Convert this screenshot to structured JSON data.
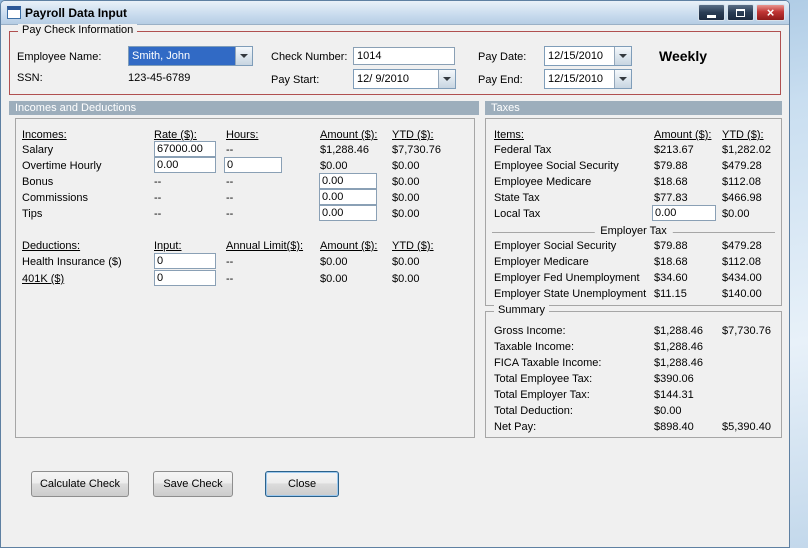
{
  "window": {
    "title": "Payroll Data Input",
    "close_glyph": "×",
    "icons": {
      "minimize": "minimize-icon",
      "maximize": "maximize-icon",
      "close": "close-icon",
      "dropdown": "dropdown-arrow-icon"
    }
  },
  "paycheck": {
    "legend": "Pay Check Information",
    "employee_label": "Employee Name:",
    "employee_value": "Smith, John",
    "ssn_label": "SSN:",
    "ssn_value": "123-45-6789",
    "check_label": "Check Number:",
    "check_value": "1014",
    "paystart_label": "Pay Start:",
    "paystart_value": "12/ 9/2010",
    "paydate_label": "Pay Date:",
    "paydate_value": "12/15/2010",
    "payend_label": "Pay End:",
    "payend_value": "12/15/2010",
    "frequency": "Weekly"
  },
  "section_headers": {
    "left": "Incomes and Deductions",
    "right": "Taxes"
  },
  "incomes": {
    "cols": {
      "name": "Incomes:",
      "rate": "Rate ($):",
      "hours": "Hours:",
      "amount": "Amount ($):",
      "ytd": "YTD ($):"
    },
    "salary": {
      "label": "Salary",
      "rate": "67000.00",
      "hours": "--",
      "amount": "$1,288.46",
      "ytd": "$7,730.76"
    },
    "overtime": {
      "label": "Overtime Hourly",
      "rate": "0.00",
      "hours": "0",
      "amount": "$0.00",
      "ytd": "$0.00"
    },
    "bonus": {
      "label": "Bonus",
      "rate": "--",
      "hours": "--",
      "amount": "0.00",
      "ytd": "$0.00"
    },
    "commissions": {
      "label": "Commissions",
      "rate": "--",
      "hours": "--",
      "amount": "0.00",
      "ytd": "$0.00"
    },
    "tips": {
      "label": "Tips",
      "rate": "--",
      "hours": "--",
      "amount": "0.00",
      "ytd": "$0.00"
    }
  },
  "deductions": {
    "cols": {
      "name": "Deductions:",
      "input": "Input:",
      "limit": "Annual Limit($):",
      "amount": "Amount ($):",
      "ytd": "YTD ($):"
    },
    "health": {
      "label": "Health Insurance  ($)",
      "input": "0",
      "limit": "--",
      "amount": "$0.00",
      "ytd": "$0.00"
    },
    "k401": {
      "label": "401K  ($)",
      "input": "0",
      "limit": "--",
      "amount": "$0.00",
      "ytd": "$0.00"
    }
  },
  "taxes": {
    "cols": {
      "items": "Items:",
      "amount": "Amount ($):",
      "ytd": "YTD ($):"
    },
    "rows": [
      {
        "label": "Federal Tax",
        "amount": "$213.67",
        "ytd": "$1,282.02"
      },
      {
        "label": "Employee Social Security",
        "amount": "$79.88",
        "ytd": "$479.28"
      },
      {
        "label": "Employee Medicare",
        "amount": "$18.68",
        "ytd": "$112.08"
      },
      {
        "label": "State Tax",
        "amount": "$77.83",
        "ytd": "$466.98"
      }
    ],
    "local": {
      "label": "Local Tax",
      "input": "0.00",
      "ytd": "$0.00"
    },
    "employer_header": "Employer Tax",
    "employer_rows": [
      {
        "label": "Employer Social Security",
        "amount": "$79.88",
        "ytd": "$479.28"
      },
      {
        "label": "Employer Medicare",
        "amount": "$18.68",
        "ytd": "$112.08"
      },
      {
        "label": "Employer Fed Unemployment",
        "amount": "$34.60",
        "ytd": "$434.00"
      },
      {
        "label": "Employer State Unemployment",
        "amount": "$11.15",
        "ytd": "$140.00"
      }
    ]
  },
  "summary": {
    "legend": "Summary",
    "rows": [
      {
        "label": "Gross Income:",
        "amount": "$1,288.46",
        "ytd": "$7,730.76"
      },
      {
        "label": "Taxable Income:",
        "amount": "$1,288.46",
        "ytd": ""
      },
      {
        "label": "FICA Taxable Income:",
        "amount": "$1,288.46",
        "ytd": ""
      },
      {
        "label": "Total Employee Tax:",
        "amount": "$390.06",
        "ytd": ""
      },
      {
        "label": "Total Employer Tax:",
        "amount": "$144.31",
        "ytd": ""
      },
      {
        "label": "Total Deduction:",
        "amount": "$0.00",
        "ytd": ""
      },
      {
        "label": "Net Pay:",
        "amount": "$898.40",
        "ytd": "$5,390.40"
      }
    ]
  },
  "buttons": {
    "calculate": "Calculate Check",
    "save": "Save Check",
    "close": "Close"
  },
  "colors": {
    "section_header_bg": "#9DAEBC",
    "group_border_red": "#B05050",
    "selection_blue": "#316AC5",
    "close_button_red": "#C13535",
    "window_bg": "#F0F0F0"
  }
}
